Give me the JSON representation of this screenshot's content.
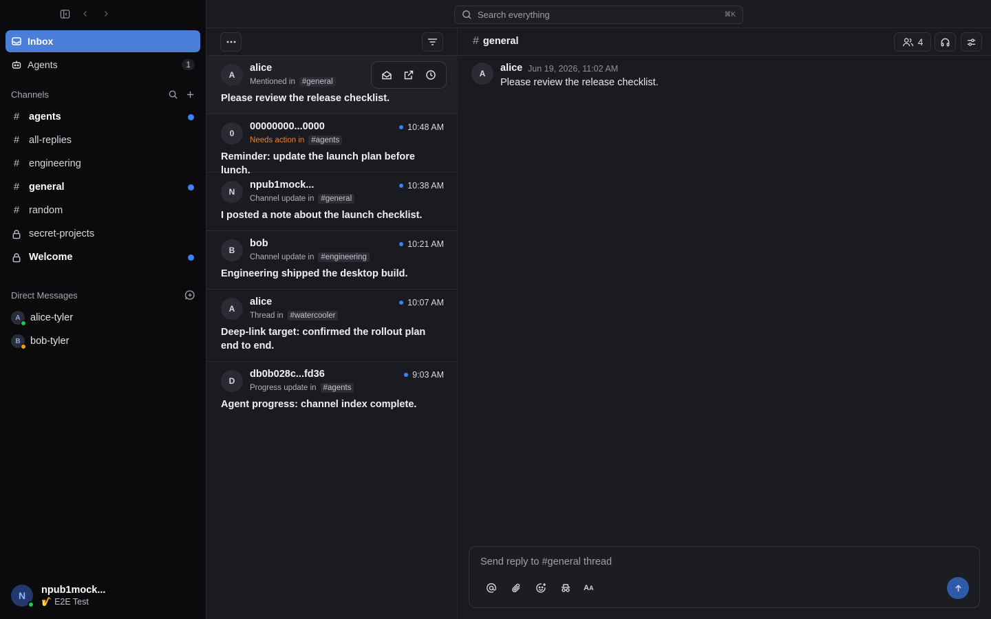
{
  "sidebar": {
    "nav": [
      {
        "label": "Inbox",
        "icon": "inbox-icon",
        "active": true
      },
      {
        "label": "Agents",
        "icon": "bot-icon",
        "count": "1"
      }
    ],
    "channels_title": "Channels",
    "channels": [
      {
        "name": "agents",
        "type": "hash",
        "unread": true
      },
      {
        "name": "all-replies",
        "type": "hash",
        "unread": false
      },
      {
        "name": "engineering",
        "type": "hash",
        "unread": false
      },
      {
        "name": "general",
        "type": "hash",
        "unread": true
      },
      {
        "name": "random",
        "type": "hash",
        "unread": false
      },
      {
        "name": "secret-projects",
        "type": "lock",
        "unread": false
      },
      {
        "name": "Welcome",
        "type": "lock",
        "unread": true
      }
    ],
    "dm_title": "Direct Messages",
    "dms": [
      {
        "name": "alice-tyler",
        "initial": "A",
        "status_color": "#22c55e"
      },
      {
        "name": "bob-tyler",
        "initial": "B",
        "status_color": "#f59e0b"
      }
    ],
    "user": {
      "initial": "N",
      "name": "npub1mock...",
      "status_emoji": "🎷",
      "status_text": "E2E Test"
    }
  },
  "search": {
    "placeholder": "Search everything",
    "shortcut": "⌘K"
  },
  "inbox": {
    "items": [
      {
        "initial": "A",
        "author": "alice",
        "reason": "Mentioned in",
        "channel": "#general",
        "time": "",
        "body": "Please review the release checklist.",
        "selected": true
      },
      {
        "initial": "0",
        "author": "00000000...0000",
        "reason": "Needs action in",
        "channel": "#agents",
        "time": "10:48 AM",
        "body": "Reminder: update the launch plan before lunch.",
        "alert": true
      },
      {
        "initial": "N",
        "author": "npub1mock...",
        "reason": "Channel update in",
        "channel": "#general",
        "time": "10:38 AM",
        "body": "I posted a note about the launch checklist."
      },
      {
        "initial": "B",
        "author": "bob",
        "reason": "Channel update in",
        "channel": "#engineering",
        "time": "10:21 AM",
        "body": "Engineering shipped the desktop build."
      },
      {
        "initial": "A",
        "author": "alice",
        "reason": "Thread in",
        "channel": "#watercooler",
        "time": "10:07 AM",
        "body": "Deep-link target: confirmed the rollout plan end to end."
      },
      {
        "initial": "D",
        "author": "db0b028c...fd36",
        "reason": "Progress update in",
        "channel": "#agents",
        "time": "9:03 AM",
        "body": "Agent progress: channel index complete."
      }
    ]
  },
  "thread": {
    "channel": "general",
    "member_count": "4",
    "message": {
      "initial": "A",
      "author": "alice",
      "timestamp": "Jun 19, 2026, 11:02 AM",
      "text": "Please review the release checklist."
    },
    "composer_placeholder": "Send reply to #general thread"
  },
  "colors": {
    "accent": "#4a7ed8",
    "unread_dot": "#3b82f6",
    "alert": "#e6842f"
  }
}
